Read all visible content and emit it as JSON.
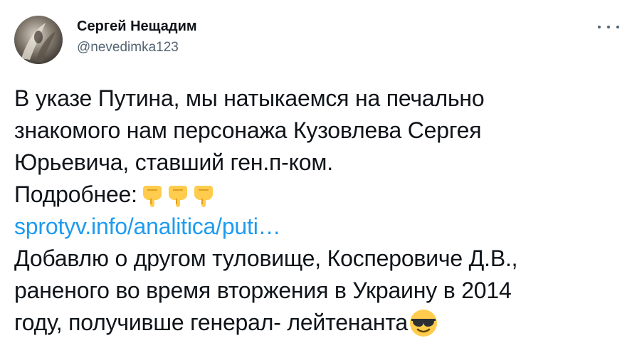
{
  "author": {
    "display_name": "Сергей Нещадим",
    "handle": "@nevedimka123"
  },
  "tweet": {
    "line1": "В указе Путина, мы натыкаемся на печально",
    "line2": "знакомого нам персонажа Кузовлева Сергея",
    "line3": "Юрьевича, ставший ген.п-ком.",
    "line4": "Подробнее:",
    "link": "sprotyv.info/analitica/puti…",
    "line6": "Добавлю о другом туловище, Косперовиче Д.В.,",
    "line7": "раненого во время вторжения в Украину в 2014",
    "line8": "году, получивше генерал- лейтенанта"
  },
  "icons": {
    "avatar": "avatar-photo",
    "more": "more-options-icon",
    "pointing_down": "backhand-index-pointing-down-emoji",
    "sunglasses": "smiling-face-with-sunglasses-emoji"
  },
  "colors": {
    "text": "#0f1419",
    "secondary": "#536471",
    "link": "#1d9bf0"
  }
}
